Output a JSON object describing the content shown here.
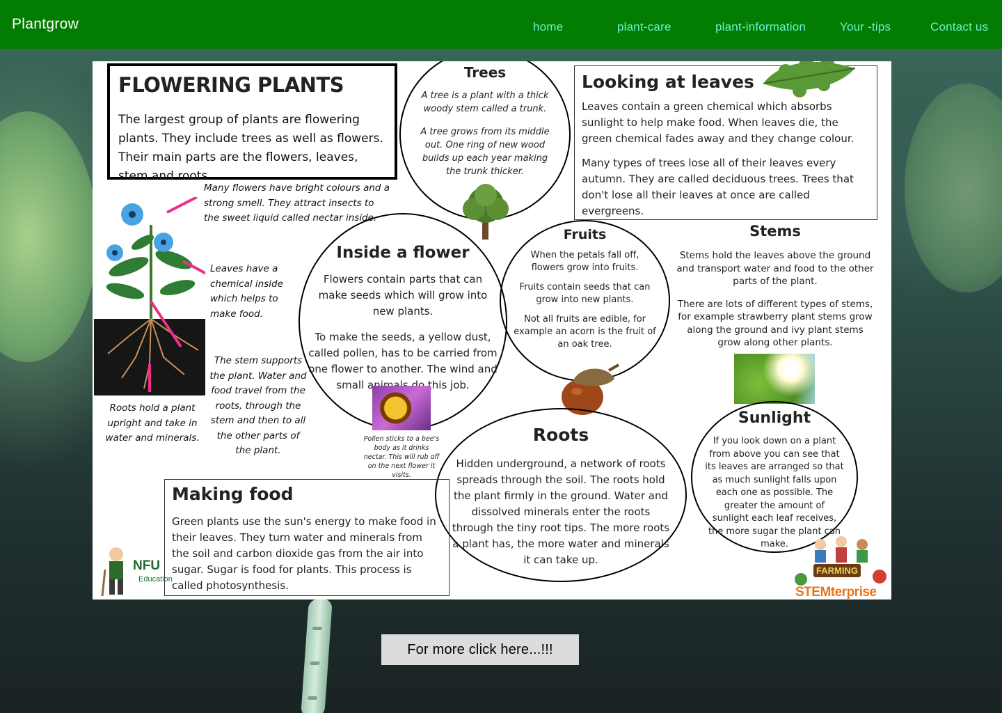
{
  "header": {
    "brand": "Plantgrow",
    "nav": [
      {
        "label": "home"
      },
      {
        "label": "plant-care"
      },
      {
        "label": "plant-information"
      },
      {
        "label": "Your -tips"
      },
      {
        "label": "Contact us"
      }
    ],
    "bg_color": "#027d02",
    "link_color": "#6ef0d0"
  },
  "poster": {
    "flowering": {
      "title": "FLOWERING PLANTS",
      "text": "The largest group of plants are flowering plants. They include trees as well as flowers. Their main parts are the flowers, leaves, stem and roots."
    },
    "trees": {
      "title": "Trees",
      "text1": "A tree is a plant with a thick woody stem called a trunk.",
      "text2": "A tree grows from its middle out. One ring of new wood builds up each year making the trunk thicker."
    },
    "leaves": {
      "title": "Looking at leaves",
      "text1": "Leaves contain a green chemical which absorbs sunlight to help make food. When leaves die, the green chemical fades away and they change colour.",
      "text2": "Many types of trees lose all of their leaves every autumn. They are called deciduous trees. Trees that don't lose all their leaves at once are called evergreens."
    },
    "notes": {
      "flowers": "Many flowers have bright colours and a strong smell. They attract insects to the sweet liquid called nectar inside.",
      "leaves": "Leaves have a chemical inside which helps to make food.",
      "stem": "The stem supports the plant. Water and food travel from the roots, through the stem and then to all the other parts of the plant.",
      "roots": "Roots hold a plant upright and take in water and minerals."
    },
    "inside": {
      "title": "Inside a flower",
      "text1": "Flowers contain parts that can make seeds which will grow into new plants.",
      "text2": "To make the seeds, a yellow dust, called pollen, has to be carried from one flower to another. The wind and small animals do this job.",
      "bee_caption": "Pollen sticks to a bee's body as it drinks nectar. This will rub off on the next flower it visits."
    },
    "fruits": {
      "title": "Fruits",
      "text1": "When the petals fall off, flowers grow into fruits.",
      "text2": "Fruits contain seeds that can grow into new plants.",
      "text3": "Not all fruits are edible, for example an acorn is the fruit of an oak tree."
    },
    "stems": {
      "title": "Stems",
      "text1": "Stems hold the leaves above the ground and transport water and food to the other parts of the plant.",
      "text2": "There are lots of different types of stems, for example strawberry plant stems grow along the ground and ivy plant stems grow along other plants."
    },
    "roots": {
      "title": "Roots",
      "text": "Hidden underground, a network of roots spreads through the soil. The roots hold the plant firmly in the ground. Water and dissolved minerals enter the roots through the tiny root tips. The more roots a plant has, the more water and minerals it can take up."
    },
    "sunlight": {
      "title": "Sunlight",
      "text": "If you look down on a plant from above you can see that its leaves are arranged so that as much sunlight falls upon each one as possible. The greater the amount of sunlight each leaf receives, the more sugar the plant can make."
    },
    "food": {
      "title": "Making food",
      "text": "Green plants use the sun's energy to make food in their leaves. They turn water and minerals from the soil and carbon dioxide gas from the air into sugar. Sugar is food for plants. This process is called photosynthesis."
    },
    "logos": {
      "nfu": "NFU",
      "nfu_sub": "Education",
      "farming_top": "FARMING",
      "farming_bottom": "STEMterprise"
    }
  },
  "cta": {
    "label": "For more click here...!!!"
  }
}
